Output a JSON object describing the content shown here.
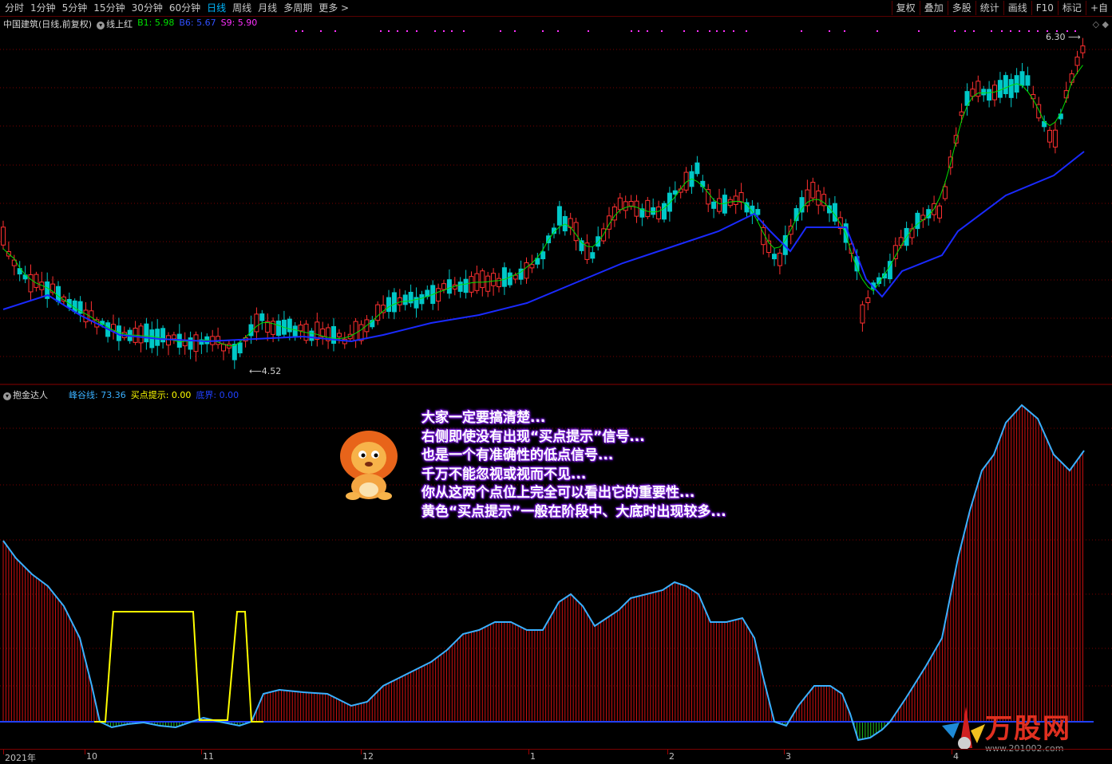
{
  "toolbar": {
    "periods": [
      "分时",
      "1分钟",
      "5分钟",
      "15分钟",
      "30分钟",
      "60分钟",
      "日线",
      "周线",
      "月线",
      "多周期",
      "更多 >"
    ],
    "active_period": "日线",
    "right_buttons": [
      "复权",
      "叠加",
      "多股",
      "统计",
      "画线",
      "F10",
      "标记",
      "+自"
    ]
  },
  "main_panel": {
    "title": "中国建筑(日线,前复权)",
    "indicator": "线上红",
    "b1_label": "B1: 5.98",
    "b6_label": "B6: 5.67",
    "s9_label": "S9: 5.90",
    "high_marker": "6.30",
    "low_marker": "4.52",
    "colors": {
      "b1": "#00e000",
      "b6": "#3050ff",
      "s9": "#ff30ff",
      "up": "#ff3030",
      "down": "#00c8c8",
      "ma_fast": "#00e000",
      "ma_slow": "#1a2aff",
      "signal_dots": "#ff30ff"
    }
  },
  "sub_panel": {
    "indicator": "抱金达人",
    "peak_label": "峰谷线: 73.36",
    "buy_label": "买点提示: 0.00",
    "bottom_label": "底界: 0.00",
    "colors": {
      "peak": "#3ab0ff",
      "buy": "#ffff00",
      "bottom": "#2040ff",
      "bars_pos": "#cc1010",
      "bars_neg": "#20c020"
    }
  },
  "popup": {
    "lines": [
      "大家一定要搞清楚...",
      "右侧即使没有出现“买点提示”信号...",
      "也是一个有准确性的低点信号...",
      "千万不能忽视或视而不见...",
      "你从这两个点位上完全可以看出它的重要性...",
      "黄色“买点提示”一般在阶段中、大底时出现较多..."
    ]
  },
  "date_axis": {
    "labels": [
      "2021年",
      "10",
      "11",
      "12",
      "1",
      "2",
      "3",
      "4"
    ]
  },
  "watermark": {
    "brand": "万股网",
    "url": "www.201002.com"
  },
  "icons": [
    "gear-icon",
    "lion-mascot-icon",
    "diamond-icon",
    "arrow-icon"
  ]
}
